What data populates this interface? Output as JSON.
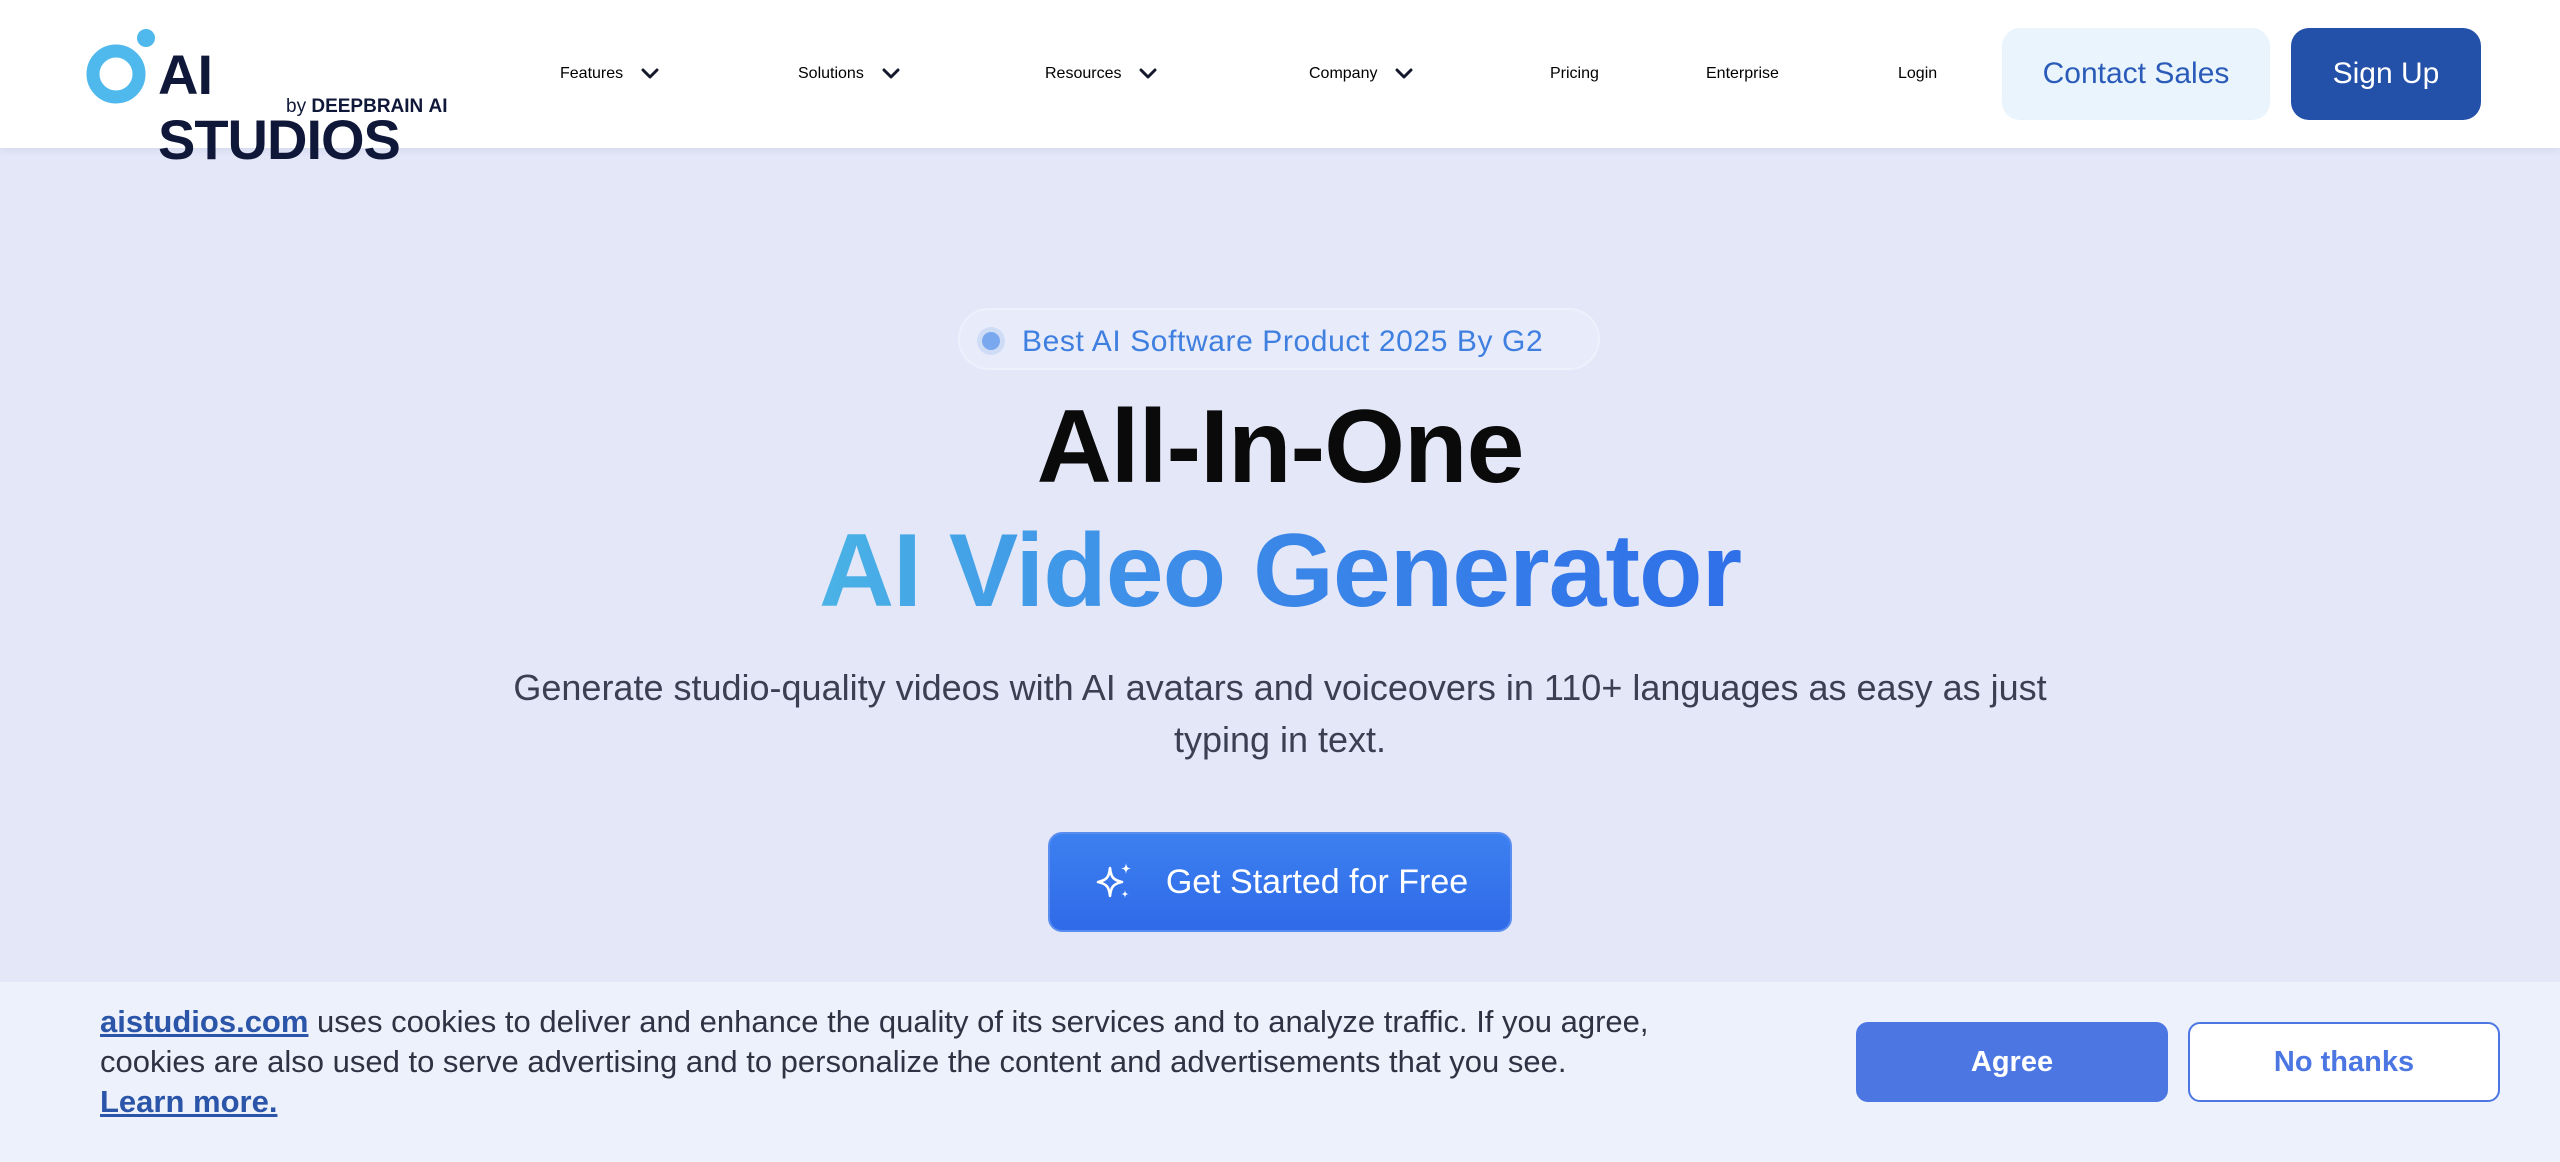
{
  "header": {
    "logo": {
      "name": "AI STUDIOS",
      "by": "by",
      "brand": "DEEPBRAIN",
      "brand_suffix": "AI"
    },
    "nav": [
      {
        "label": "Features",
        "dropdown": true
      },
      {
        "label": "Solutions",
        "dropdown": true
      },
      {
        "label": "Resources",
        "dropdown": true
      },
      {
        "label": "Company",
        "dropdown": true
      },
      {
        "label": "Pricing",
        "dropdown": false
      },
      {
        "label": "Enterprise",
        "dropdown": false
      },
      {
        "label": "Login",
        "dropdown": false
      }
    ],
    "contact_sales": "Contact Sales",
    "sign_up": "Sign Up"
  },
  "hero": {
    "badge": "Best AI Software Product 2025 By G2",
    "headline_line1": "All-In-One",
    "headline_line2": "AI Video Generator",
    "subtitle": "Generate studio-quality videos with AI avatars and voiceovers in 110+ languages as easy as just typing in text.",
    "cta_label": "Get Started for Free",
    "cta_icon": "sparkle-icon"
  },
  "cookie_banner": {
    "site_link": "aistudios.com",
    "message": " uses cookies to deliver and enhance the quality of its services and to analyze traffic. If you agree, cookies are also used to serve advertising and to personalize the content and advertisements that you see.",
    "learn_more": "Learn more.",
    "agree": "Agree",
    "no_thanks": "No thanks"
  },
  "colors": {
    "brand_blue": "#2f6fe8",
    "signup_bg": "#2350a8",
    "contact_bg": "#eaf4fd",
    "page_bg": "#e3e7f8",
    "gradient_start": "#4ab3e6",
    "agree_bg": "#4c77e3"
  }
}
